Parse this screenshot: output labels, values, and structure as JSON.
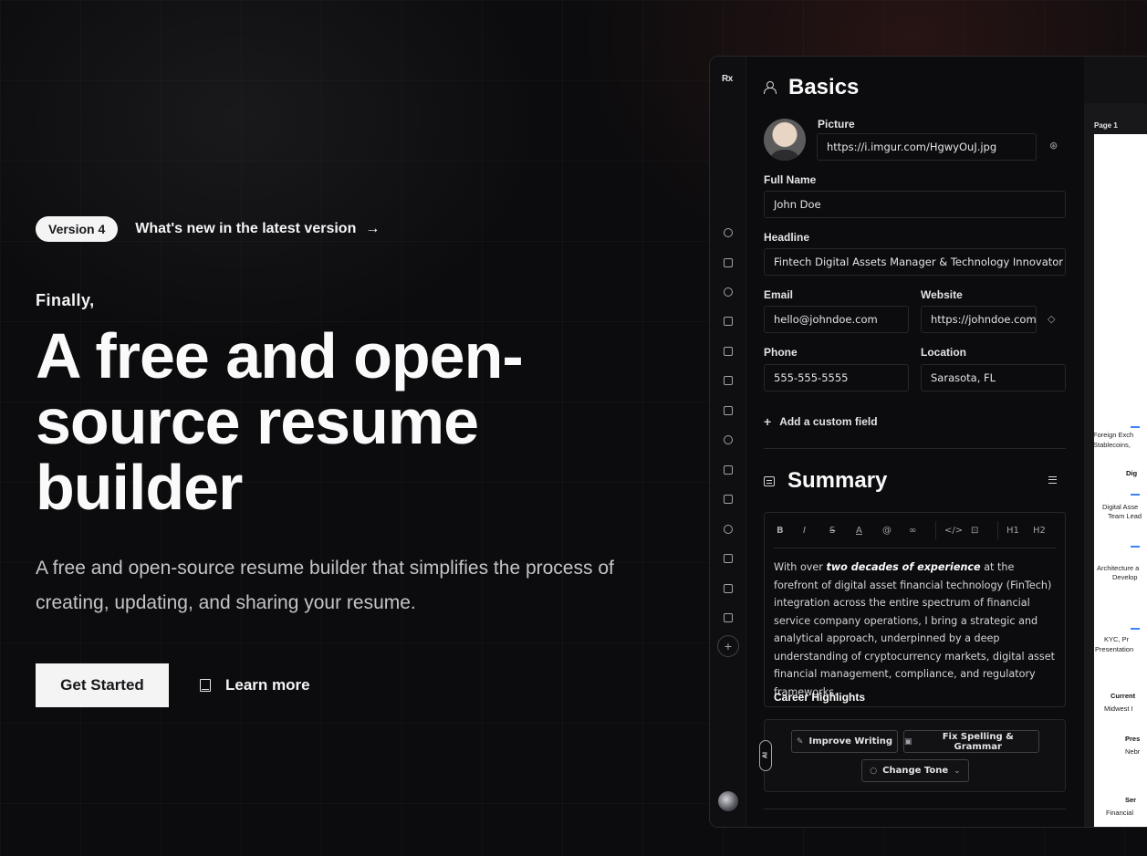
{
  "hero": {
    "version_badge": "Version 4",
    "whats_new": "What's new in the latest version",
    "arrow": "→",
    "kicker": "Finally,",
    "headline": "A free and open-source resume builder",
    "subtitle": "A free and open-source resume builder that simplifies the process of creating, updating, and sharing your resume.",
    "cta_primary": "Get Started",
    "cta_secondary": "Learn more"
  },
  "app": {
    "logo": "Rx",
    "basics": {
      "title": "Basics",
      "picture_label": "Picture",
      "picture_value": "https://i.imgur.com/HgwyOuJ.jpg",
      "fullname_label": "Full Name",
      "fullname_value": "John Doe",
      "headline_label": "Headline",
      "headline_value": "Fintech Digital Assets Manager & Technology Innovator",
      "email_label": "Email",
      "email_value": "hello@johndoe.com",
      "website_label": "Website",
      "website_value": "https://johndoe.com",
      "phone_label": "Phone",
      "phone_value": "555-555-5555",
      "location_label": "Location",
      "location_value": "Sarasota, FL",
      "add_custom": "Add a custom field"
    },
    "summary": {
      "title": "Summary",
      "toolbar": [
        "B",
        "I",
        "S",
        "A",
        "@",
        "∞",
        "</>",
        "⊡",
        "H1",
        "H2"
      ],
      "text_before": "With over ",
      "text_em": "two decades of experience",
      "text_after": " at the forefront of digital asset financial technology (FinTech) integration across the entire spectrum of financial service company operations, I bring a strategic and analytical approach, underpinned by a deep understanding of cryptocurrency markets, digital asset financial management, compliance, and regulatory frameworks.",
      "career_heading": "Career Highlights"
    },
    "ai": {
      "tag": "AI",
      "improve": "Improve Writing",
      "fix": "Fix Spelling & Grammar",
      "tone": "Change Tone"
    },
    "preview": {
      "page_label": "Page 1",
      "snippets": [
        "Foreign Exch",
        "Stablecoins,",
        "Dig",
        "Digital Asse",
        "Team Lead",
        "Architecture a",
        "Develop",
        "KYC, Pr",
        "Presentation",
        "Current",
        "Midwest I",
        "Pres",
        "Nebr",
        "Ser",
        "Financial"
      ]
    }
  }
}
